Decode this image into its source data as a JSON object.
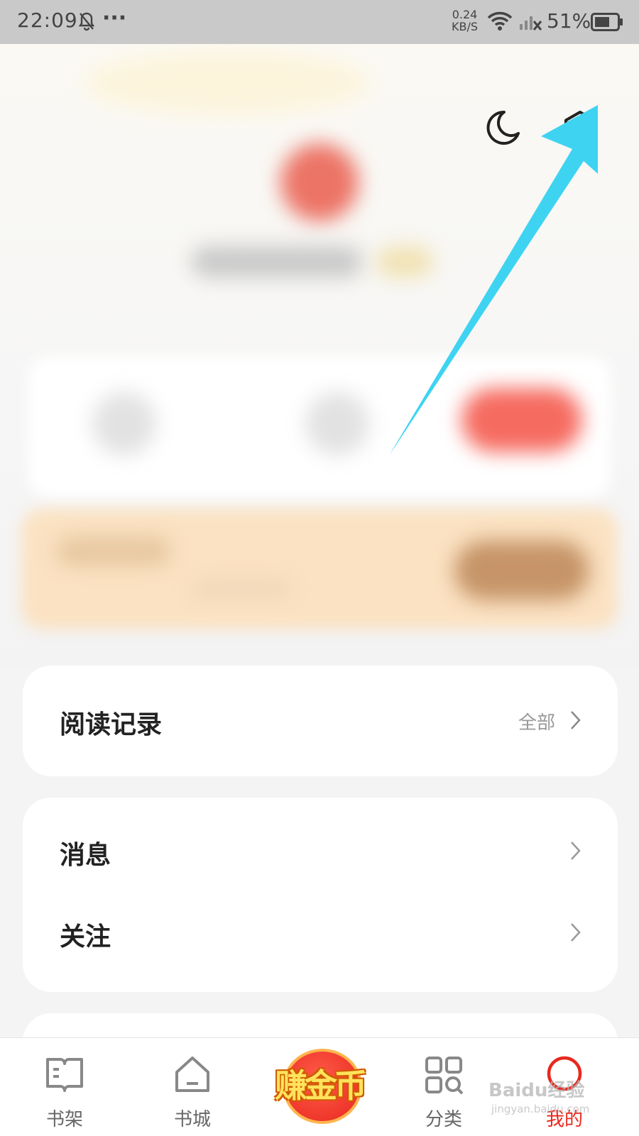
{
  "status_bar": {
    "time": "22:09",
    "more": "···",
    "speed_value": "0.24",
    "speed_unit": "KB/S",
    "battery": "51%"
  },
  "header": {
    "icons": [
      "moon-icon",
      "settings-icon"
    ]
  },
  "reading_record": {
    "title": "阅读记录",
    "all_label": "全部"
  },
  "menu": {
    "messages": "消息",
    "following": "关注"
  },
  "tabbar": {
    "bookshelf": "书架",
    "bookstore": "书城",
    "earn": "赚金币",
    "category": "分类",
    "mine": "我的"
  },
  "colors": {
    "active_tab": "#e8281e",
    "arrow": "#3fd3f2"
  },
  "watermark": {
    "brand": "Baidu经验",
    "url": "jingyan.baidu.com"
  }
}
